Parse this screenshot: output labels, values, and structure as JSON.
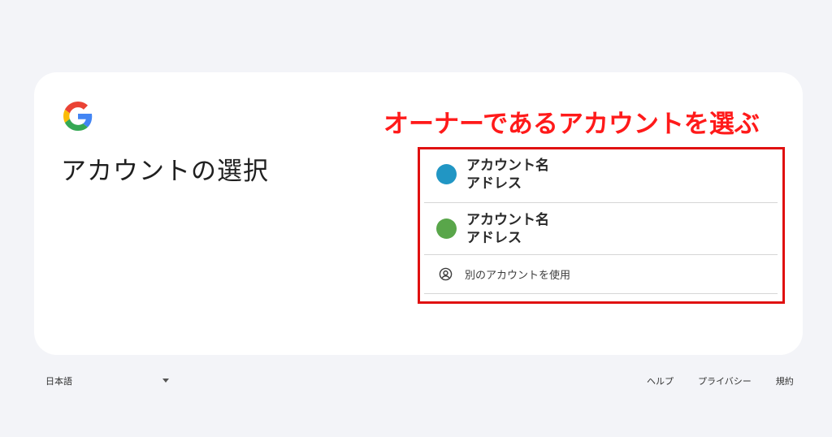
{
  "header": {
    "logo": "google-g-logo",
    "title": "アカウントの選択"
  },
  "annotation": {
    "text": "オーナーであるアカウントを選ぶ",
    "color": "#ff1a1a"
  },
  "accounts": [
    {
      "name": "アカウント名",
      "email": "アドレス",
      "avatar_color": "#2196c4"
    },
    {
      "name": "アカウント名",
      "email": "アドレス",
      "avatar_color": "#59a64a"
    }
  ],
  "other_account": {
    "icon": "account-circle-icon",
    "label": "別のアカウントを使用"
  },
  "footer": {
    "language": "日本語",
    "links": [
      "ヘルプ",
      "プライバシー",
      "規約"
    ]
  }
}
